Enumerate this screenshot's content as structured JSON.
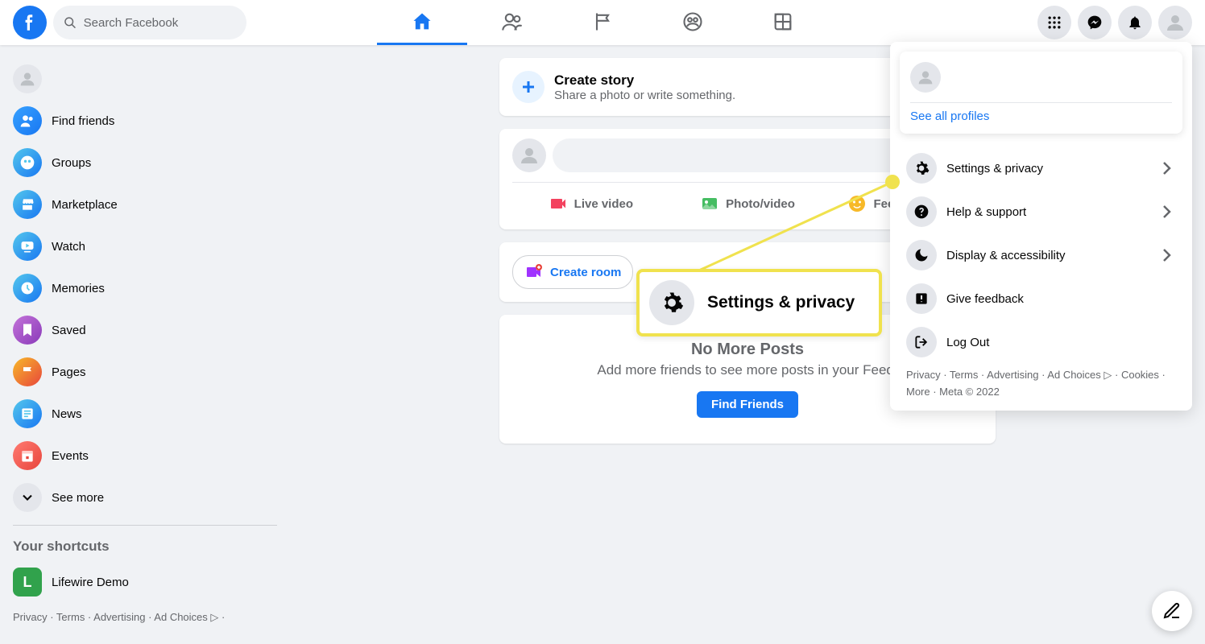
{
  "header": {
    "search_placeholder": "Search Facebook"
  },
  "sidebar": {
    "items": [
      {
        "label": "Find friends"
      },
      {
        "label": "Groups"
      },
      {
        "label": "Marketplace"
      },
      {
        "label": "Watch"
      },
      {
        "label": "Memories"
      },
      {
        "label": "Saved"
      },
      {
        "label": "Pages"
      },
      {
        "label": "News"
      },
      {
        "label": "Events"
      },
      {
        "label": "See more"
      }
    ],
    "shortcuts_title": "Your shortcuts",
    "shortcuts": [
      {
        "label": "Lifewire Demo",
        "initial": "L"
      }
    ],
    "footer": "Privacy · Terms · Advertising · Ad Choices ▷ ·"
  },
  "feed": {
    "story": {
      "title": "Create story",
      "sub": "Share a photo or write something."
    },
    "composer": {
      "live": "Live video",
      "photo": "Photo/video",
      "feeling": "Feeling/activity"
    },
    "room": {
      "create": "Create room"
    },
    "noposts": {
      "title": "No More Posts",
      "sub": "Add more friends to see more posts in your Feed.",
      "btn": "Find Friends"
    }
  },
  "dropdown": {
    "see_all": "See all profiles",
    "items": [
      {
        "label": "Settings & privacy",
        "chevron": true
      },
      {
        "label": "Help & support",
        "chevron": true
      },
      {
        "label": "Display & accessibility",
        "chevron": true
      },
      {
        "label": "Give feedback",
        "chevron": false
      },
      {
        "label": "Log Out",
        "chevron": false
      }
    ],
    "footer": "Privacy · Terms · Advertising · Ad Choices ▷ · Cookies · More · Meta © 2022"
  },
  "callout": {
    "label": "Settings & privacy"
  }
}
